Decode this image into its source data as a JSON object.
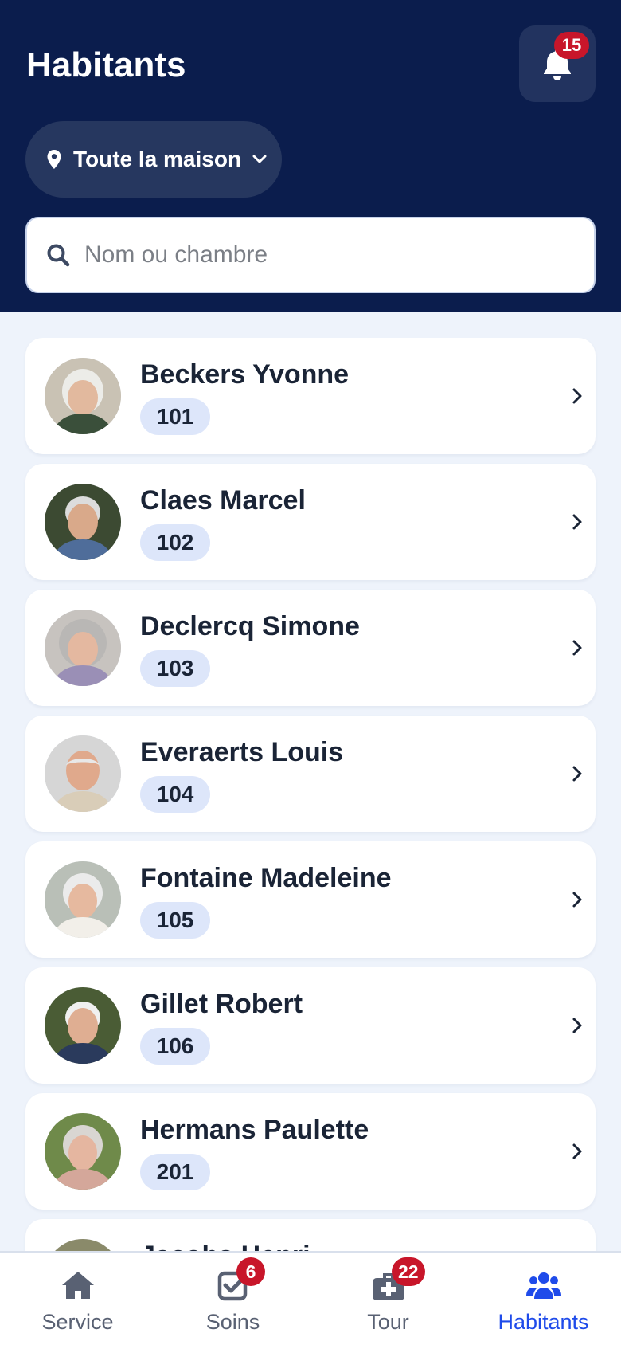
{
  "header": {
    "title": "Habitants",
    "notifications_count": "15",
    "location_filter": "Toute la maison"
  },
  "search": {
    "placeholder": "Nom ou chambre",
    "value": ""
  },
  "residents": [
    {
      "name": "Beckers Yvonne",
      "room": "101"
    },
    {
      "name": "Claes Marcel",
      "room": "102"
    },
    {
      "name": "Declercq Simone",
      "room": "103"
    },
    {
      "name": "Everaerts Louis",
      "room": "104"
    },
    {
      "name": "Fontaine Madeleine",
      "room": "105"
    },
    {
      "name": "Gillet Robert",
      "room": "106"
    },
    {
      "name": "Hermans Paulette",
      "room": "201"
    },
    {
      "name": "Jacobs Henri",
      "room": ""
    }
  ],
  "tabbar": {
    "tabs": [
      {
        "label": "Service",
        "icon": "home-icon",
        "badge": ""
      },
      {
        "label": "Soins",
        "icon": "check-square-icon",
        "badge": "6"
      },
      {
        "label": "Tour",
        "icon": "medical-kit-icon",
        "badge": "22"
      },
      {
        "label": "Habitants",
        "icon": "users-icon",
        "badge": "",
        "active": true
      }
    ]
  },
  "colors": {
    "header_bg": "#0b1d4d",
    "page_bg": "#eef3fb",
    "accent": "#1f4bea",
    "badge": "#c8162a",
    "room_chip": "#dde6fa"
  }
}
